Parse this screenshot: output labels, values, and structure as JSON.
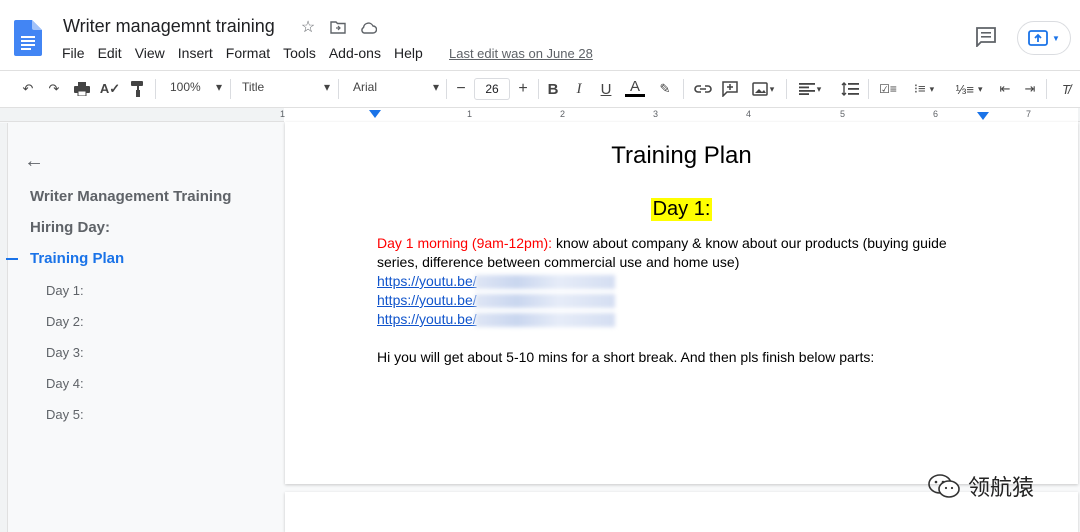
{
  "title_bar": {
    "doc_title": "Writer managemnt training",
    "last_edit": "Last edit was on June 28",
    "menu": [
      "File",
      "Edit",
      "View",
      "Insert",
      "Format",
      "Tools",
      "Add-ons",
      "Help"
    ]
  },
  "toolbar": {
    "zoom": "100%",
    "style": "Title",
    "font": "Arial",
    "font_size": "26",
    "bold": "B",
    "italic": "I",
    "underline": "U",
    "text_color": "A"
  },
  "ruler": {
    "numbers": [
      "1",
      "1",
      "2",
      "3",
      "4",
      "5",
      "6",
      "7"
    ]
  },
  "outline": {
    "items": [
      {
        "label": "Writer Management Training",
        "level": 1
      },
      {
        "label": "Hiring Day:",
        "level": 1
      },
      {
        "label": "Training Plan",
        "level": 1,
        "active": true
      },
      {
        "label": "Day 1:",
        "level": 2
      },
      {
        "label": "Day 2:",
        "level": 2
      },
      {
        "label": "Day 3:",
        "level": 2
      },
      {
        "label": "Day 4:",
        "level": 2
      },
      {
        "label": "Day 5:",
        "level": 2
      }
    ]
  },
  "document": {
    "heading": "Training Plan",
    "subheading": "Day 1:",
    "para1_red": "Day 1 morning (9am-12pm):",
    "para1_text": " know about company & know about our products (buying guide series, difference between commercial use and home use)",
    "links": [
      "https://youtu.be/",
      "https://youtu.be/",
      "https://youtu.be/"
    ],
    "para2": "Hi you will get about 5-10 mins for a short break. And then pls finish below parts:"
  },
  "colors": {
    "accent": "#1a73e8",
    "highlight": "#ffff00",
    "red_text": "#ff0000",
    "link": "#1155cc"
  },
  "watermark": "领航猿"
}
